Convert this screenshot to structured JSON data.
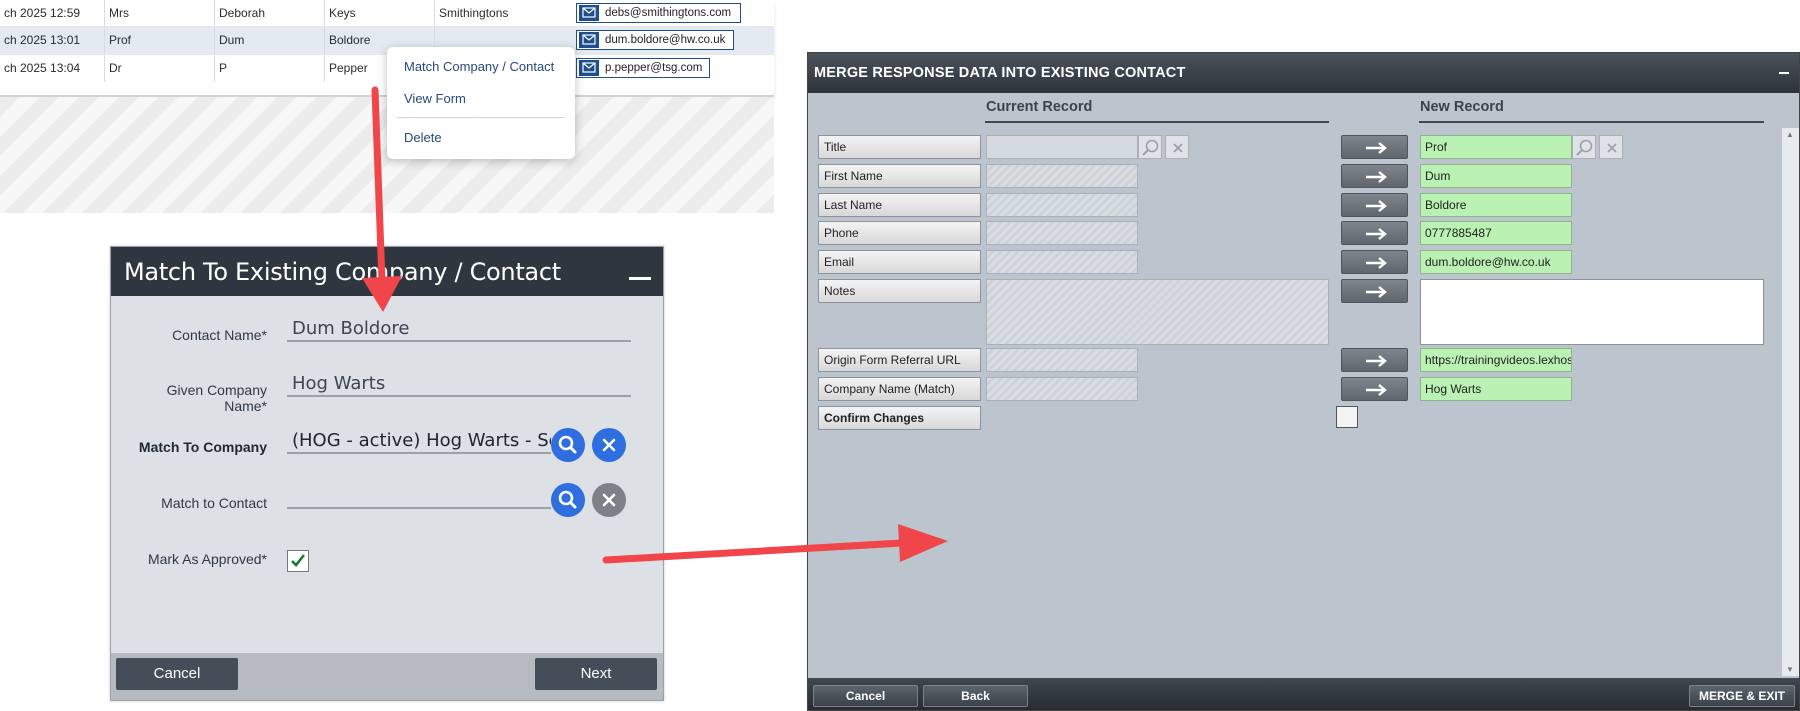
{
  "table": {
    "rows": [
      {
        "date": "ch 2025 12:59",
        "title": "Mrs",
        "first": "Deborah",
        "last": "Keys",
        "company": "Smithingtons",
        "email": "debs@smithingtons.com"
      },
      {
        "date": "ch 2025 13:01",
        "title": "Prof",
        "first": "Dum",
        "last": "Boldore",
        "company": "",
        "email": "dum.boldore@hw.co.uk"
      },
      {
        "date": "ch 2025 13:04",
        "title": "Dr",
        "first": "P",
        "last": "Pepper",
        "company": "",
        "email": "p.pepper@tsg.com"
      }
    ]
  },
  "context_menu": {
    "items": [
      "Match Company / Contact",
      "View Form",
      "Delete"
    ]
  },
  "match_dialog": {
    "title": "Match To Existing Company / Contact",
    "contact_name_label": "Contact Name*",
    "contact_name_value": "Dum Boldore",
    "given_company_label_line1": "Given Company",
    "given_company_label_line2": "Name*",
    "given_company_value": "Hog Warts",
    "match_company_label": "Match To Company",
    "match_company_value": "(HOG - active) Hog Warts - Scho",
    "match_contact_label": "Match to Contact",
    "match_contact_value": "",
    "approved_label": "Mark As Approved*",
    "approved_checked": true,
    "cancel_label": "Cancel",
    "next_label": "Next"
  },
  "merge_dialog": {
    "title": "MERGE RESPONSE DATA INTO EXISTING CONTACT",
    "current_header": "Current Record",
    "new_header": "New Record",
    "fields": [
      {
        "label": "Title",
        "new_value": "Prof"
      },
      {
        "label": "First Name",
        "new_value": "Dum"
      },
      {
        "label": "Last Name",
        "new_value": "Boldore"
      },
      {
        "label": "Phone",
        "new_value": "0777885487"
      },
      {
        "label": "Email",
        "new_value": "dum.boldore@hw.co.uk"
      },
      {
        "label": "Notes",
        "new_value": ""
      },
      {
        "label": "Origin Form Referral URL",
        "new_value": "https://trainingvideos.lexhos"
      },
      {
        "label": "Company Name (Match)",
        "new_value": "Hog Warts"
      }
    ],
    "confirm_label": "Confirm Changes",
    "confirm_checked": false,
    "cancel_label": "Cancel",
    "back_label": "Back",
    "merge_label": "MERGE & EXIT"
  },
  "colors": {
    "annotation_arrow": "#f0464a",
    "new_value_bg": "#b9f2b2",
    "match_header_bg": "#2f3640",
    "search_button": "#2f6ee0"
  }
}
